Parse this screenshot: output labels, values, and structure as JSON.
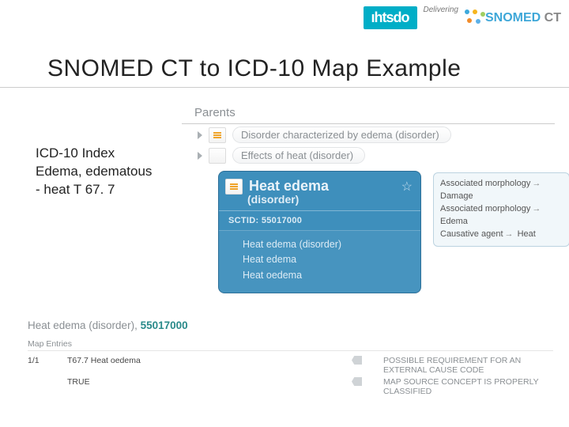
{
  "header": {
    "ihtsdo_text": "ıhtsdo",
    "delivering_label": "Delivering",
    "brand_part1": "SNOMED",
    "brand_part2": " CT"
  },
  "title": "SNOMED CT to ICD-10 Map Example",
  "icd_index": {
    "line1": "ICD-10 Index",
    "line2": "Edema, edematous",
    "line3": "- heat T 67. 7"
  },
  "parents": {
    "heading": "Parents",
    "items": [
      "Disorder characterized by edema (disorder)",
      "Effects of heat (disorder)"
    ]
  },
  "concept": {
    "title": "Heat edema",
    "subtitle": "(disorder)",
    "sctid_label": "SCTID: 55017000",
    "synonyms": [
      "Heat edema (disorder)",
      "Heat edema",
      "Heat oedema"
    ],
    "star_glyph": "☆"
  },
  "attributes": {
    "rows": [
      {
        "name": "Associated morphology",
        "value": "Damage"
      },
      {
        "name": "Associated morphology",
        "value": "Edema"
      },
      {
        "name": "Causative agent",
        "value": "Heat"
      }
    ]
  },
  "map_section": {
    "title_concept": "Heat edema (disorder)",
    "title_sep": ", ",
    "title_id": "55017000",
    "entries_label": "Map Entries",
    "col1a": "1/1",
    "col2a": "T67.7 Heat oedema",
    "col3a": "TRUE",
    "tag_rows": [
      "POSSIBLE REQUIREMENT FOR AN EXTERNAL CAUSE CODE",
      "MAP SOURCE CONCEPT IS PROPERLY CLASSIFIED"
    ]
  }
}
